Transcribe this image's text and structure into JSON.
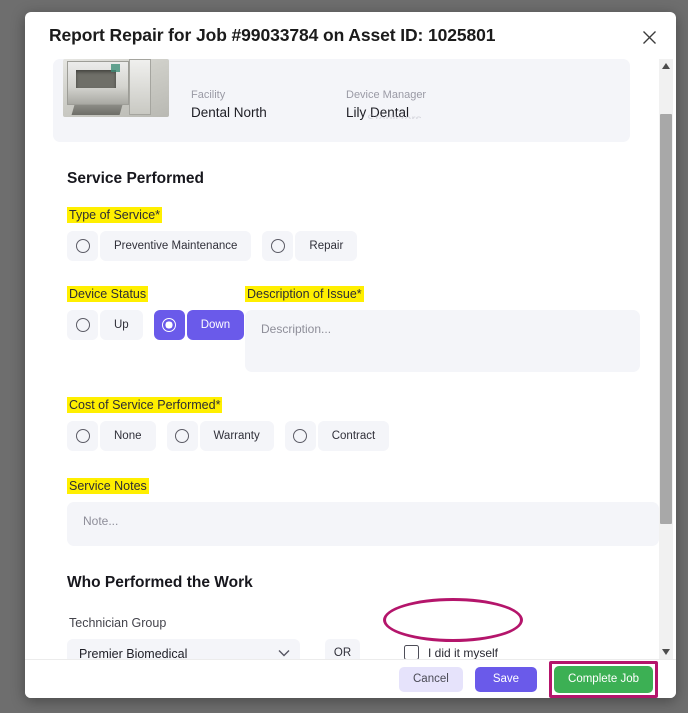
{
  "dialog": {
    "title": "Report Repair for Job #99033784 on Asset ID: 1025801",
    "close_label": "×"
  },
  "device_card": {
    "clipped_text": "Sterilizers",
    "fields": [
      {
        "label": "Facility",
        "value": "Dental North"
      },
      {
        "label": "Device Manager",
        "value": "Lily Dental"
      }
    ]
  },
  "service_performed": {
    "heading": "Service Performed",
    "type_of_service": {
      "label": "Type of Service*",
      "options": [
        {
          "label": "Preventive Maintenance",
          "selected": false
        },
        {
          "label": "Repair",
          "selected": false
        }
      ]
    },
    "device_status": {
      "label": "Device Status",
      "options": [
        {
          "label": "Up",
          "selected": false
        },
        {
          "label": "Down",
          "selected": true
        }
      ]
    },
    "description_of_issue": {
      "label": "Description of Issue*",
      "value": "",
      "placeholder": "Description..."
    },
    "cost_of_service": {
      "label": "Cost of Service Performed*",
      "options": [
        {
          "label": "None",
          "selected": false
        },
        {
          "label": "Warranty",
          "selected": false
        },
        {
          "label": "Contract",
          "selected": false
        }
      ]
    },
    "service_notes": {
      "label": "Service Notes",
      "value": "",
      "placeholder": "Note..."
    }
  },
  "who_performed": {
    "heading": "Who Performed the Work",
    "technician_group": {
      "label": "Technician Group",
      "value": "Premier Biomedical",
      "chevron": "chevron-down-icon"
    },
    "or_text": "OR",
    "did_it_myself": {
      "label": "I did it myself",
      "checked": false
    }
  },
  "footer": {
    "cancel_label": "Cancel",
    "save_label": "Save",
    "complete_label": "Complete Job"
  },
  "colors": {
    "accent_purple": "#6a5aea",
    "success_green": "#3cb054",
    "highlight_yellow": "#ffef00",
    "annotation_pink": "#b4156b",
    "field_bg": "#f4f5f9",
    "backdrop": "#6e6e6e"
  },
  "scrollbar": {
    "up_arrow": "triangle-up-icon",
    "down_arrow": "triangle-down-icon"
  }
}
